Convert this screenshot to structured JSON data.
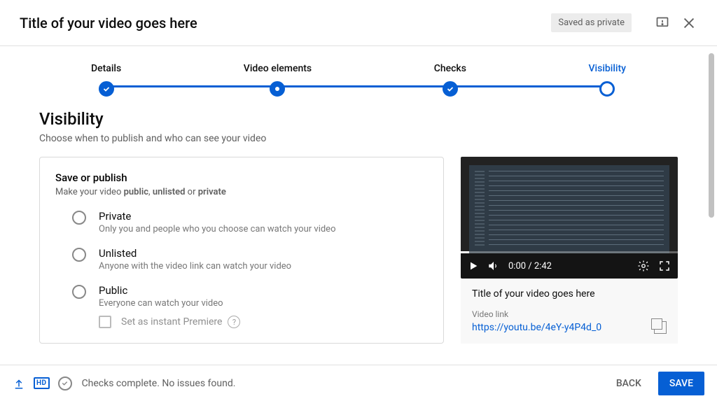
{
  "header": {
    "title": "Title of your video goes here",
    "status": "Saved as private"
  },
  "stepper": {
    "steps": [
      {
        "label": "Details"
      },
      {
        "label": "Video elements"
      },
      {
        "label": "Checks"
      },
      {
        "label": "Visibility"
      }
    ]
  },
  "visibility": {
    "heading": "Visibility",
    "subheading": "Choose when to publish and who can see your video",
    "card": {
      "title": "Save or publish",
      "sub_pre": "Make your video ",
      "sub_bold1": "public",
      "sub_mid1": ", ",
      "sub_bold2": "unlisted",
      "sub_mid2": " or ",
      "sub_bold3": "private"
    },
    "options": [
      {
        "title": "Private",
        "desc": "Only you and people who you choose can watch your video"
      },
      {
        "title": "Unlisted",
        "desc": "Anyone with the video link can watch your video"
      },
      {
        "title": "Public",
        "desc": "Everyone can watch your video"
      }
    ],
    "premiere": {
      "label": "Set as instant Premiere"
    }
  },
  "preview": {
    "time": "0:00 / 2:42",
    "title": "Title of your video goes here",
    "link_label": "Video link",
    "link": "https://youtu.be/4eY-y4P4d_0"
  },
  "footer": {
    "hd": "HD",
    "status": "Checks complete. No issues found.",
    "back": "BACK",
    "save": "SAVE"
  }
}
